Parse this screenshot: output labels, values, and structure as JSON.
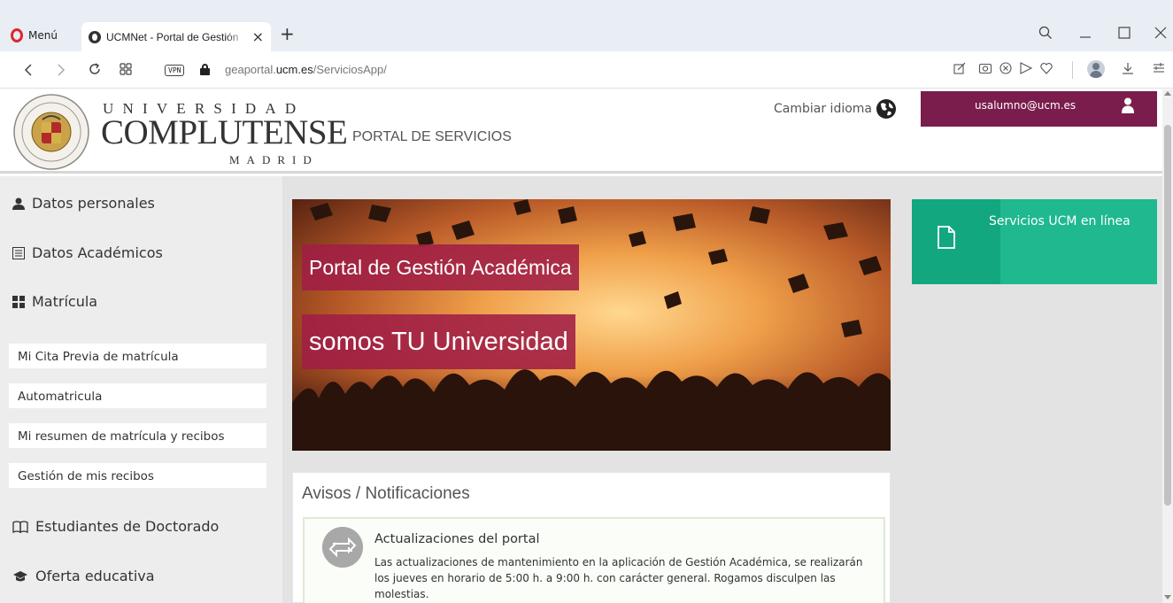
{
  "browser": {
    "menu_label": "Menú",
    "tab_title": "UCMNet - Portal de Gestión",
    "tab_close": "×",
    "new_tab": "+",
    "vpn": "VPN",
    "url_prefix": "geaportal.",
    "url_host": "ucm.es",
    "url_path": "/ServiciosApp/"
  },
  "header": {
    "uni_line1": "UNIVERSIDAD",
    "uni_line2": "COMPLUTENSE",
    "uni_line3": "MADRID",
    "portal_title": "PORTAL DE SERVICIOS",
    "change_language": "Cambiar idioma",
    "user_email": "usalumno@ucm.es"
  },
  "sidebar": {
    "items": [
      {
        "label": "Datos personales",
        "icon": "user-icon"
      },
      {
        "label": "Datos Académicos",
        "icon": "list-icon"
      },
      {
        "label": "Matrícula",
        "icon": "grid-icon"
      }
    ],
    "subitems": [
      "Mi Cita Previa de matrícula",
      "Automatricula",
      "Mi resumen de matrícula y recibos",
      "Gestión de mis recibos"
    ],
    "items_after": [
      {
        "label": "Estudiantes de Doctorado",
        "icon": "book-icon"
      },
      {
        "label": "Oferta educativa",
        "icon": "graduation-cap-icon"
      }
    ]
  },
  "banner": {
    "line1": "Portal de Gestión Académica",
    "line2": "somos TU Universidad"
  },
  "notices": {
    "title": "Avisos / Notificaciones",
    "item_title": "Actualizaciones del portal",
    "item_body": "Las actualizaciones de mantenimiento en la aplicación de Gestión Académica, se realizarán los jueves en horario de 5:00 h. a 9:00 h. con carácter general. Rogamos disculpen las molestias."
  },
  "services": {
    "label": "Servicios UCM en línea"
  },
  "colors": {
    "brand_maroon": "#7a1d4d",
    "banner_label": "#a01e46",
    "services_green": "#1fb88f"
  }
}
